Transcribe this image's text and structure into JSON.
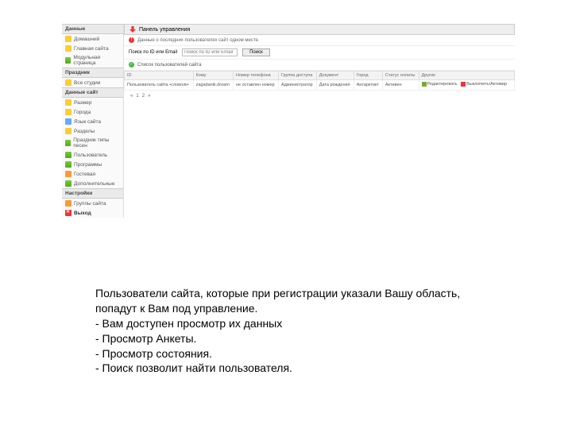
{
  "sidebar": {
    "sec1": {
      "title": "Данные",
      "items": [
        {
          "label": "Домашний",
          "ic": "ic-yellow",
          "name": "home"
        },
        {
          "label": "Главная сайта",
          "ic": "ic-yellow",
          "name": "site-home"
        },
        {
          "label": "Модульная страница",
          "ic": "ic-green",
          "name": "module-page"
        }
      ]
    },
    "sec2": {
      "title": "Праздник",
      "items": [
        {
          "label": "Все студии",
          "ic": "ic-yellow",
          "name": "all-studios"
        }
      ]
    },
    "sec3": {
      "title": "Данные сайт",
      "items": [
        {
          "label": "Размер",
          "ic": "ic-yellow",
          "name": "size"
        },
        {
          "label": "Города",
          "ic": "ic-yellow",
          "name": "cities"
        },
        {
          "label": "Язык сайта",
          "ic": "ic-blue",
          "name": "lang"
        },
        {
          "label": "Разделы",
          "ic": "ic-yellow",
          "name": "sections"
        },
        {
          "label": "Праздник типы песен",
          "ic": "ic-green",
          "name": "song-types"
        },
        {
          "label": "Пользователь",
          "ic": "ic-green",
          "name": "users"
        },
        {
          "label": "Программы",
          "ic": "ic-green",
          "name": "programs"
        },
        {
          "label": "Гостевая",
          "ic": "ic-orange",
          "name": "guestbook"
        },
        {
          "label": "Дополнительные",
          "ic": "ic-green",
          "name": "extra"
        }
      ]
    },
    "sec4": {
      "title": "Настройки",
      "items": [
        {
          "label": "Группы сайта",
          "ic": "ic-orange",
          "name": "site-groups"
        }
      ]
    },
    "exit": {
      "label": "Выход",
      "name": "exit"
    }
  },
  "panel": {
    "title": "Панель управления",
    "subtext": "Данные о последних пользователях сайт одном месте.",
    "search_label": "Поиск по ID или Email",
    "search_button": "Поиск",
    "status_text": "Список пользователей сайта"
  },
  "table": {
    "headers": [
      "ID",
      "Кому",
      "Номер телефона",
      "Группа доступа",
      "Документ",
      "Город",
      "Статус оплаты",
      "Другие"
    ],
    "row": {
      "id": "Пользователь сайта •словолк•",
      "email": "zagadanik.dream",
      "phone": "не оставлен номер",
      "group": "Администратор",
      "doc": "Дата рождения",
      "city": "Антарктикт",
      "status": "Активен"
    },
    "actions": {
      "edit": "Редактировать",
      "delete": "Выключить\\Активир"
    }
  },
  "pager": {
    "pages": [
      "«",
      "1",
      "2",
      "»"
    ]
  },
  "description": {
    "p1": "Пользователи сайта, которые при регистрации указали Вашу область, попадут к Вам под управление.",
    "b1": " - Вам доступен просмотр их данных",
    "b2": " - Просмотр Анкеты.",
    "b3": " - Просмотр состояния.",
    "b4": " - Поиск позволит найти пользователя."
  }
}
